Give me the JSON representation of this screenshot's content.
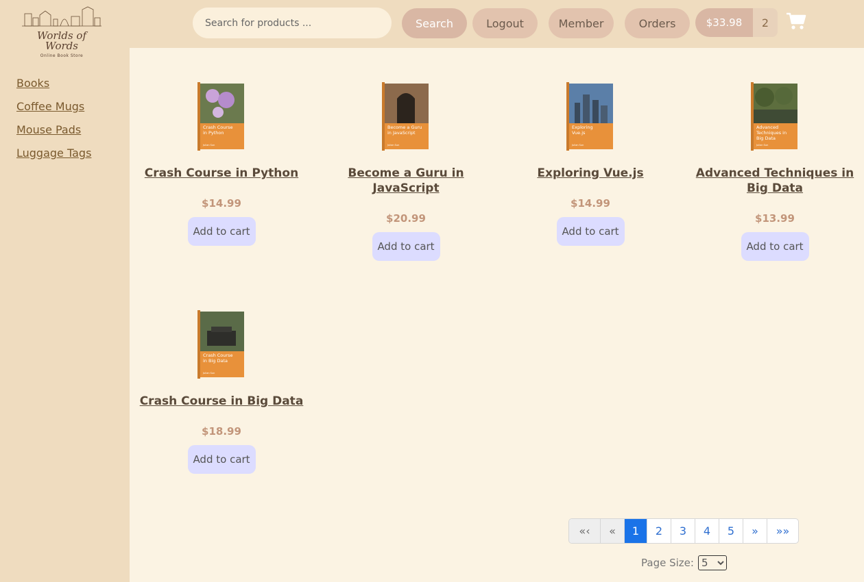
{
  "logo": {
    "line1": "Worlds of",
    "line2": "Words",
    "tagline": "Online Book Store"
  },
  "sidebar": {
    "items": [
      {
        "label": "Books"
      },
      {
        "label": "Coffee Mugs"
      },
      {
        "label": "Mouse Pads"
      },
      {
        "label": "Luggage Tags"
      }
    ]
  },
  "header": {
    "search_placeholder": "Search for products ...",
    "search_label": "Search",
    "logout_label": "Logout",
    "member_label": "Member",
    "orders_label": "Orders",
    "cart_total": "$33.98",
    "cart_count": "2",
    "cart_icon": "shopping-cart-icon"
  },
  "products": [
    {
      "title": "Crash Course in Python",
      "price": "$14.99",
      "button": "Add to cart",
      "cover_text": "Crash Course in Python",
      "cover_author": "Julian Sun"
    },
    {
      "title": "Become a Guru in JavaScript",
      "price": "$20.99",
      "button": "Add to cart",
      "cover_text": "Become a Guru in JavaScript",
      "cover_author": "Julian Sun"
    },
    {
      "title": "Exploring Vue.js",
      "price": "$14.99",
      "button": "Add to cart",
      "cover_text": "Exploring Vue.js",
      "cover_author": "Julian Sun"
    },
    {
      "title": "Advanced Techniques in Big Data",
      "price": "$13.99",
      "button": "Add to cart",
      "cover_text": "Advanced Techniques in Big Data",
      "cover_author": "Julian Sun"
    },
    {
      "title": "Crash Course in Big Data",
      "price": "$18.99",
      "button": "Add to cart",
      "cover_text": "Crash Course in Big Data",
      "cover_author": "Julian Sun"
    }
  ],
  "pagination": {
    "first": "«‹",
    "prev": "«",
    "pages": [
      "1",
      "2",
      "3",
      "4",
      "5"
    ],
    "current": "1",
    "next": "»",
    "last": "»»"
  },
  "page_size": {
    "label": "Page Size:",
    "value": "5"
  },
  "colors": {
    "sidebar_bg": "#efdcbf",
    "page_bg": "#fbf3e3",
    "accent": "#1a73e8",
    "cover_orange": "#e8913a"
  }
}
